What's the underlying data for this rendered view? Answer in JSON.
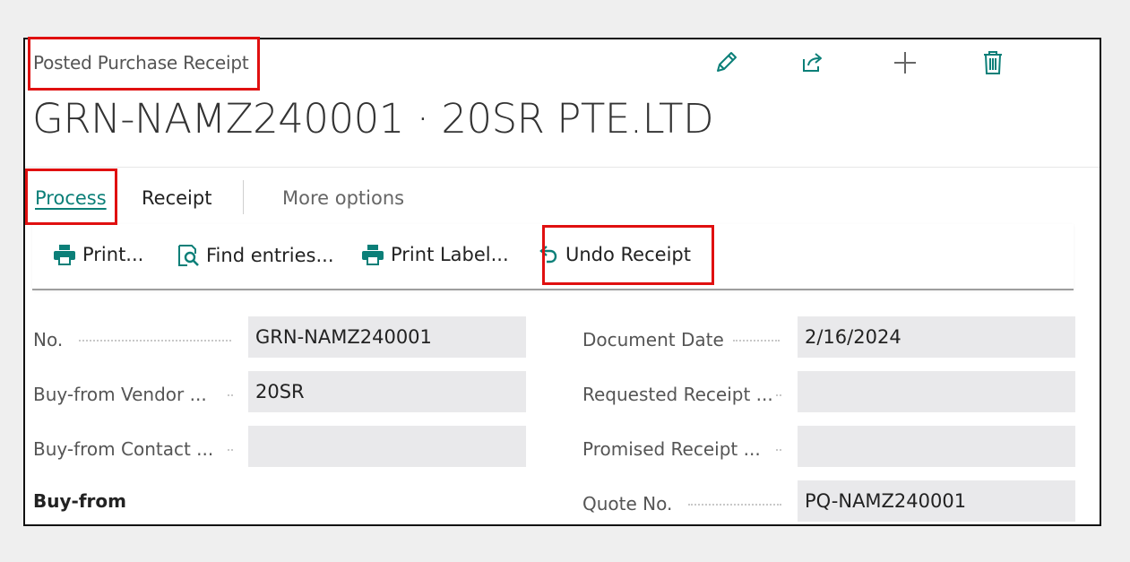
{
  "header": {
    "page_type": "Posted Purchase Receipt",
    "title": "GRN-NAMZ240001 · 20SR PTE.LTD",
    "icons": [
      "edit-icon",
      "share-icon",
      "new-icon",
      "delete-icon"
    ]
  },
  "tabs": [
    {
      "label": "Process",
      "active": true
    },
    {
      "label": "Receipt",
      "active": false
    },
    {
      "label": "More options",
      "active": false
    }
  ],
  "actions": [
    {
      "label": "Print...",
      "icon": "printer-icon"
    },
    {
      "label": "Find entries...",
      "icon": "find-entries-icon"
    },
    {
      "label": "Print Label...",
      "icon": "printer-icon"
    },
    {
      "label": "Undo Receipt",
      "icon": "undo-icon"
    }
  ],
  "fields_left": [
    {
      "label": "No.",
      "value": "GRN-NAMZ240001"
    },
    {
      "label": "Buy-from Vendor ...",
      "value": "20SR"
    },
    {
      "label": "Buy-from Contact ...",
      "value": ""
    },
    {
      "label": "Buy-from",
      "value": ""
    }
  ],
  "fields_right": [
    {
      "label": "Document Date",
      "value": "2/16/2024"
    },
    {
      "label": "Requested Receipt ...",
      "value": ""
    },
    {
      "label": "Promised Receipt ...",
      "value": ""
    },
    {
      "label": "Quote No.",
      "value": "PQ-NAMZ240001"
    }
  ],
  "colors": {
    "accent": "#0b7f78",
    "highlight": "#e01010",
    "field_bg": "#e9e9eb"
  }
}
